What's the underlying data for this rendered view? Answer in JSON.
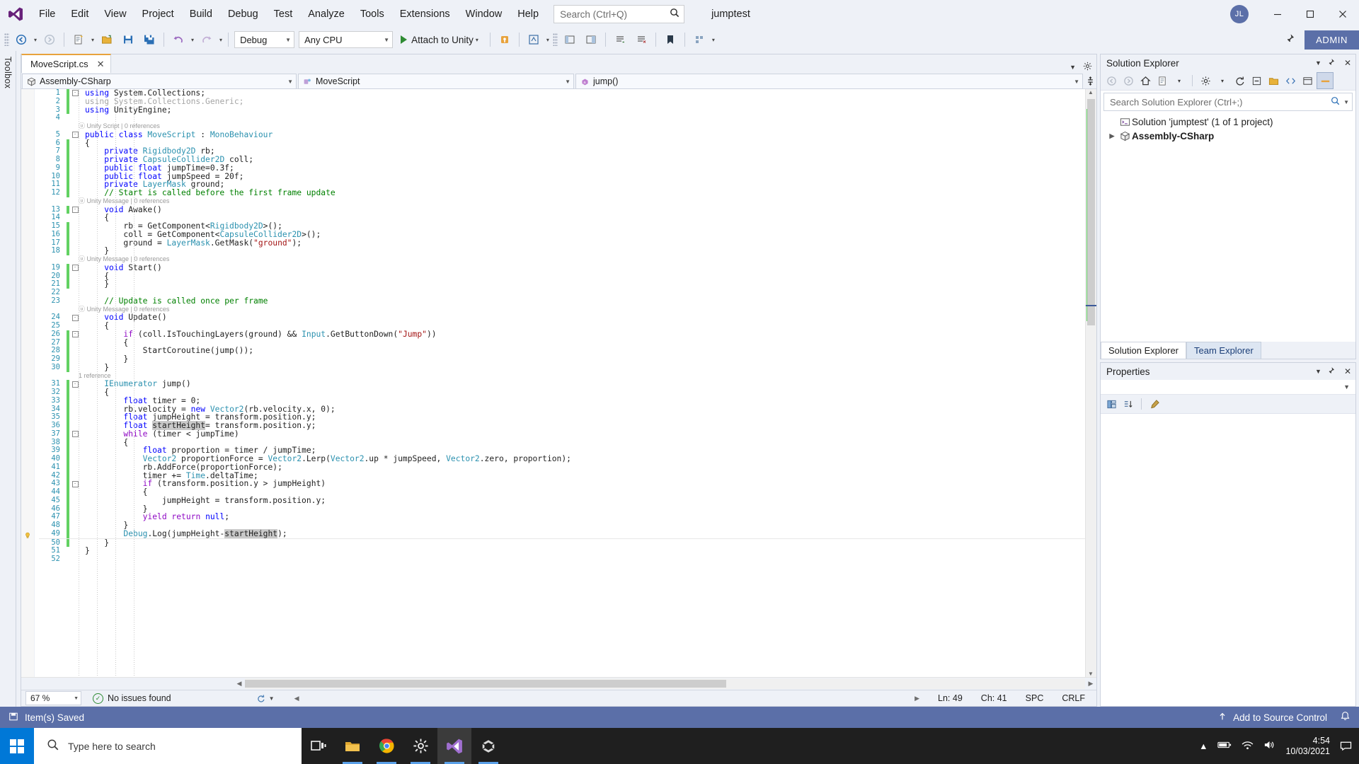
{
  "titlebar": {
    "menu": [
      "File",
      "Edit",
      "View",
      "Project",
      "Build",
      "Debug",
      "Test",
      "Analyze",
      "Tools",
      "Extensions",
      "Window",
      "Help"
    ],
    "search_placeholder": "Search (Ctrl+Q)",
    "project_name": "jumptest",
    "avatar_initials": "JL",
    "minimize": "–",
    "maximize": "❐",
    "close": "✕"
  },
  "toolbar": {
    "configuration": "Debug",
    "platform": "Any CPU",
    "run_label": "Attach to Unity",
    "admin_label": "ADMIN"
  },
  "toolbox": {
    "label": "Toolbox"
  },
  "editor": {
    "tab_title": "MoveScript.cs",
    "tab_close": "✕",
    "nav_project": "Assembly-CSharp",
    "nav_type": "MoveScript",
    "nav_member": "jump()",
    "zoom": "67 %",
    "issues": "No issues found",
    "line_label": "Ln: 49",
    "char_label": "Ch: 41",
    "spc": "SPC",
    "crlf": "CRLF"
  },
  "code": {
    "lines": [
      {
        "n": "1",
        "change": true,
        "fold": "-",
        "indent": 0,
        "tokens": [
          {
            "t": "using ",
            "c": "kw"
          },
          {
            "t": "System.Collections;",
            "c": "id"
          }
        ]
      },
      {
        "n": "2",
        "change": true,
        "fold": "",
        "indent": 1,
        "tokens": [
          {
            "t": "using ",
            "c": "dim"
          },
          {
            "t": "System.Collections.Generic;",
            "c": "dim"
          }
        ]
      },
      {
        "n": "3",
        "change": true,
        "fold": "",
        "indent": 1,
        "tokens": [
          {
            "t": "using ",
            "c": "kw"
          },
          {
            "t": "UnityEngine;",
            "c": "id"
          }
        ]
      },
      {
        "n": "4",
        "change": false,
        "fold": "",
        "indent": 0,
        "tokens": []
      },
      {
        "n": "",
        "lens": "ⓤ Unity Script | 0 references"
      },
      {
        "n": "5",
        "change": false,
        "fold": "-",
        "indent": 0,
        "tokens": [
          {
            "t": "public class ",
            "c": "kw"
          },
          {
            "t": "MoveScript",
            "c": "typ"
          },
          {
            "t": " : ",
            "c": "id"
          },
          {
            "t": "MonoBehaviour",
            "c": "typ"
          }
        ]
      },
      {
        "n": "6",
        "change": true,
        "fold": "",
        "indent": 0,
        "tokens": [
          {
            "t": "{",
            "c": "id"
          }
        ]
      },
      {
        "n": "7",
        "change": true,
        "fold": "",
        "indent": 1,
        "tokens": [
          {
            "t": "    private ",
            "c": "kw"
          },
          {
            "t": "Rigidbody2D",
            "c": "typ"
          },
          {
            "t": " rb;",
            "c": "id"
          }
        ]
      },
      {
        "n": "8",
        "change": true,
        "fold": "",
        "indent": 1,
        "tokens": [
          {
            "t": "    private ",
            "c": "kw"
          },
          {
            "t": "CapsuleCollider2D",
            "c": "typ"
          },
          {
            "t": " coll;",
            "c": "id"
          }
        ]
      },
      {
        "n": "9",
        "change": true,
        "fold": "",
        "indent": 1,
        "tokens": [
          {
            "t": "    public float ",
            "c": "kw"
          },
          {
            "t": "jumpTime=0.3f;",
            "c": "id"
          }
        ]
      },
      {
        "n": "10",
        "change": true,
        "fold": "",
        "indent": 1,
        "tokens": [
          {
            "t": "    public float ",
            "c": "kw"
          },
          {
            "t": "jumpSpeed = 20f;",
            "c": "id"
          }
        ]
      },
      {
        "n": "11",
        "change": true,
        "fold": "",
        "indent": 1,
        "tokens": [
          {
            "t": "    private ",
            "c": "kw"
          },
          {
            "t": "LayerMask",
            "c": "typ"
          },
          {
            "t": " ground;",
            "c": "id"
          }
        ]
      },
      {
        "n": "12",
        "change": true,
        "fold": "",
        "indent": 1,
        "tokens": [
          {
            "t": "    // Start is called before the first frame update",
            "c": "cmt"
          }
        ]
      },
      {
        "n": "",
        "lens": "ⓤ Unity Message | 0 references"
      },
      {
        "n": "13",
        "change": true,
        "fold": "-",
        "indent": 1,
        "tokens": [
          {
            "t": "    void ",
            "c": "kw"
          },
          {
            "t": "Awake",
            "c": "id"
          },
          {
            "t": "()",
            "c": "id"
          }
        ]
      },
      {
        "n": "14",
        "change": false,
        "fold": "",
        "indent": 1,
        "tokens": [
          {
            "t": "    {",
            "c": "id"
          }
        ]
      },
      {
        "n": "15",
        "change": true,
        "fold": "",
        "indent": 2,
        "tokens": [
          {
            "t": "        rb = GetComponent<",
            "c": "id"
          },
          {
            "t": "Rigidbody2D",
            "c": "typ"
          },
          {
            "t": ">();",
            "c": "id"
          }
        ]
      },
      {
        "n": "16",
        "change": true,
        "fold": "",
        "indent": 2,
        "tokens": [
          {
            "t": "        coll = GetComponent<",
            "c": "id"
          },
          {
            "t": "CapsuleCollider2D",
            "c": "typ"
          },
          {
            "t": ">();",
            "c": "id"
          }
        ]
      },
      {
        "n": "17",
        "change": true,
        "fold": "",
        "indent": 2,
        "tokens": [
          {
            "t": "        ground = ",
            "c": "id"
          },
          {
            "t": "LayerMask",
            "c": "typ"
          },
          {
            "t": ".GetMask(",
            "c": "id"
          },
          {
            "t": "\"ground\"",
            "c": "str"
          },
          {
            "t": ");",
            "c": "id"
          }
        ]
      },
      {
        "n": "18",
        "change": true,
        "fold": "",
        "indent": 1,
        "tokens": [
          {
            "t": "    }",
            "c": "id"
          }
        ]
      },
      {
        "n": "",
        "lens": "ⓤ Unity Message | 0 references"
      },
      {
        "n": "19",
        "change": true,
        "fold": "-",
        "indent": 1,
        "tokens": [
          {
            "t": "    void ",
            "c": "kw"
          },
          {
            "t": "Start",
            "c": "id"
          },
          {
            "t": "()",
            "c": "id"
          }
        ]
      },
      {
        "n": "20",
        "change": true,
        "fold": "",
        "indent": 1,
        "tokens": [
          {
            "t": "    {",
            "c": "id"
          }
        ]
      },
      {
        "n": "21",
        "change": true,
        "fold": "",
        "indent": 1,
        "tokens": [
          {
            "t": "    }",
            "c": "id"
          }
        ]
      },
      {
        "n": "22",
        "change": false,
        "fold": "",
        "indent": 1,
        "tokens": []
      },
      {
        "n": "23",
        "change": false,
        "fold": "",
        "indent": 1,
        "tokens": [
          {
            "t": "    // Update is called once per frame",
            "c": "cmt"
          }
        ]
      },
      {
        "n": "",
        "lens": "ⓤ Unity Message | 0 references"
      },
      {
        "n": "24",
        "change": false,
        "fold": "-",
        "indent": 1,
        "tokens": [
          {
            "t": "    void ",
            "c": "kw"
          },
          {
            "t": "Update",
            "c": "id"
          },
          {
            "t": "()",
            "c": "id"
          }
        ]
      },
      {
        "n": "25",
        "change": false,
        "fold": "",
        "indent": 1,
        "tokens": [
          {
            "t": "    {",
            "c": "id"
          }
        ]
      },
      {
        "n": "26",
        "change": true,
        "fold": "-",
        "indent": 2,
        "tokens": [
          {
            "t": "        ",
            "c": "id"
          },
          {
            "t": "if",
            "c": "ctl"
          },
          {
            "t": " (coll.",
            "c": "id"
          },
          {
            "t": "IsTouchingLayers",
            "c": "id"
          },
          {
            "t": "(ground) && ",
            "c": "id"
          },
          {
            "t": "Input",
            "c": "typ"
          },
          {
            "t": ".GetButtonDown(",
            "c": "id"
          },
          {
            "t": "\"Jump\"",
            "c": "str"
          },
          {
            "t": "))",
            "c": "id"
          }
        ]
      },
      {
        "n": "27",
        "change": true,
        "fold": "",
        "indent": 2,
        "tokens": [
          {
            "t": "        {",
            "c": "id"
          }
        ]
      },
      {
        "n": "28",
        "change": true,
        "fold": "",
        "indent": 3,
        "tokens": [
          {
            "t": "            StartCoroutine(jump());",
            "c": "id"
          }
        ]
      },
      {
        "n": "29",
        "change": true,
        "fold": "",
        "indent": 2,
        "tokens": [
          {
            "t": "        }",
            "c": "id"
          }
        ]
      },
      {
        "n": "30",
        "change": true,
        "fold": "",
        "indent": 1,
        "tokens": [
          {
            "t": "    }",
            "c": "id"
          }
        ]
      },
      {
        "n": "",
        "lens": "1 reference"
      },
      {
        "n": "31",
        "change": true,
        "fold": "-",
        "indent": 1,
        "tokens": [
          {
            "t": "    IEnumerator",
            "c": "typ"
          },
          {
            "t": " jump()",
            "c": "id"
          }
        ]
      },
      {
        "n": "32",
        "change": true,
        "fold": "",
        "indent": 1,
        "tokens": [
          {
            "t": "    {",
            "c": "id"
          }
        ]
      },
      {
        "n": "33",
        "change": true,
        "fold": "",
        "indent": 2,
        "tokens": [
          {
            "t": "        float ",
            "c": "kw"
          },
          {
            "t": "timer = 0;",
            "c": "id"
          }
        ]
      },
      {
        "n": "34",
        "change": true,
        "fold": "",
        "indent": 2,
        "tokens": [
          {
            "t": "        rb.velocity = ",
            "c": "id"
          },
          {
            "t": "new",
            "c": "kw"
          },
          {
            "t": " ",
            "c": "id"
          },
          {
            "t": "Vector2",
            "c": "typ"
          },
          {
            "t": "(rb.velocity.x, 0);",
            "c": "id"
          }
        ]
      },
      {
        "n": "35",
        "change": true,
        "fold": "",
        "indent": 2,
        "tokens": [
          {
            "t": "        float ",
            "c": "kw"
          },
          {
            "t": "jumpHeight = transform.position.y;",
            "c": "id"
          }
        ]
      },
      {
        "n": "36",
        "change": true,
        "fold": "",
        "indent": 2,
        "tokens": [
          {
            "t": "        float ",
            "c": "kw"
          },
          {
            "t": "startHeight",
            "c": "sel"
          },
          {
            "t": "= transform.position.y;",
            "c": "id"
          }
        ]
      },
      {
        "n": "37",
        "change": true,
        "fold": "-",
        "indent": 2,
        "tokens": [
          {
            "t": "        ",
            "c": "id"
          },
          {
            "t": "while",
            "c": "ctl"
          },
          {
            "t": " (timer < jumpTime)",
            "c": "id"
          }
        ]
      },
      {
        "n": "38",
        "change": true,
        "fold": "",
        "indent": 2,
        "tokens": [
          {
            "t": "        {",
            "c": "id"
          }
        ]
      },
      {
        "n": "39",
        "change": true,
        "fold": "",
        "indent": 3,
        "tokens": [
          {
            "t": "            float ",
            "c": "kw"
          },
          {
            "t": "proportion = timer / jumpTime;",
            "c": "id"
          }
        ]
      },
      {
        "n": "40",
        "change": true,
        "fold": "",
        "indent": 3,
        "tokens": [
          {
            "t": "            ",
            "c": "id"
          },
          {
            "t": "Vector2",
            "c": "typ"
          },
          {
            "t": " proportionForce = ",
            "c": "id"
          },
          {
            "t": "Vector2",
            "c": "typ"
          },
          {
            "t": ".Lerp(",
            "c": "id"
          },
          {
            "t": "Vector2",
            "c": "typ"
          },
          {
            "t": ".up * jumpSpeed, ",
            "c": "id"
          },
          {
            "t": "Vector2",
            "c": "typ"
          },
          {
            "t": ".zero, proportion);",
            "c": "id"
          }
        ]
      },
      {
        "n": "41",
        "change": true,
        "fold": "",
        "indent": 3,
        "tokens": [
          {
            "t": "            rb.",
            "c": "id"
          },
          {
            "t": "AddForce",
            "c": "id"
          },
          {
            "t": "(proportionForce);",
            "c": "id"
          }
        ]
      },
      {
        "n": "42",
        "change": true,
        "fold": "",
        "indent": 3,
        "tokens": [
          {
            "t": "            timer += ",
            "c": "id"
          },
          {
            "t": "Time",
            "c": "typ"
          },
          {
            "t": ".deltaTime;",
            "c": "id"
          }
        ]
      },
      {
        "n": "43",
        "change": true,
        "fold": "-",
        "indent": 3,
        "tokens": [
          {
            "t": "            ",
            "c": "id"
          },
          {
            "t": "if",
            "c": "ctl"
          },
          {
            "t": " (transform.position.",
            "c": "id"
          },
          {
            "t": "y",
            "c": "id"
          },
          {
            "t": " > jumpHeight)",
            "c": "id"
          }
        ]
      },
      {
        "n": "44",
        "change": true,
        "fold": "",
        "indent": 3,
        "tokens": [
          {
            "t": "            {",
            "c": "id"
          }
        ]
      },
      {
        "n": "45",
        "change": true,
        "fold": "",
        "indent": 4,
        "tokens": [
          {
            "t": "                jumpHeight = transform.position.y;",
            "c": "id"
          }
        ]
      },
      {
        "n": "46",
        "change": true,
        "fold": "",
        "indent": 3,
        "tokens": [
          {
            "t": "            }",
            "c": "id"
          }
        ]
      },
      {
        "n": "47",
        "change": true,
        "fold": "",
        "indent": 3,
        "tokens": [
          {
            "t": "            ",
            "c": "id"
          },
          {
            "t": "yield return",
            "c": "ctl"
          },
          {
            "t": " ",
            "c": "id"
          },
          {
            "t": "null",
            "c": "kw"
          },
          {
            "t": ";",
            "c": "id"
          }
        ]
      },
      {
        "n": "48",
        "change": true,
        "fold": "",
        "indent": 2,
        "tokens": [
          {
            "t": "        }",
            "c": "id"
          }
        ]
      },
      {
        "n": "49",
        "change": true,
        "fold": "",
        "indent": 2,
        "bulb": true,
        "current": true,
        "tokens": [
          {
            "t": "        ",
            "c": "id"
          },
          {
            "t": "Debug",
            "c": "typ"
          },
          {
            "t": ".Log(jumpHeight-",
            "c": "id"
          },
          {
            "t": "startHeight",
            "c": "sel"
          },
          {
            "t": ");",
            "c": "id"
          }
        ]
      },
      {
        "n": "50",
        "change": true,
        "fold": "",
        "indent": 1,
        "tokens": [
          {
            "t": "    }",
            "c": "id"
          }
        ]
      },
      {
        "n": "51",
        "change": false,
        "fold": "",
        "indent": 0,
        "tokens": [
          {
            "t": "}",
            "c": "id"
          }
        ]
      },
      {
        "n": "52",
        "change": false,
        "fold": "",
        "indent": 0,
        "tokens": []
      }
    ]
  },
  "solution_explorer": {
    "title": "Solution Explorer",
    "search_placeholder": "Search Solution Explorer (Ctrl+;)",
    "solution_node": "Solution 'jumptest' (1 of 1 project)",
    "project_node": "Assembly-CSharp",
    "tab_solution": "Solution Explorer",
    "tab_team": "Team Explorer"
  },
  "properties": {
    "title": "Properties"
  },
  "statusbar": {
    "message": "Item(s) Saved",
    "source_control": "Add to Source Control"
  },
  "taskbar": {
    "search_placeholder": "Type here to search",
    "time": "4:54",
    "date": "10/03/2021"
  },
  "colors": {
    "accent": "#5b6fa8",
    "chrome": "#eef1f7",
    "tab_accent": "#e8a33d",
    "change_green": "#62d162",
    "start_blue": "#0078d7"
  }
}
